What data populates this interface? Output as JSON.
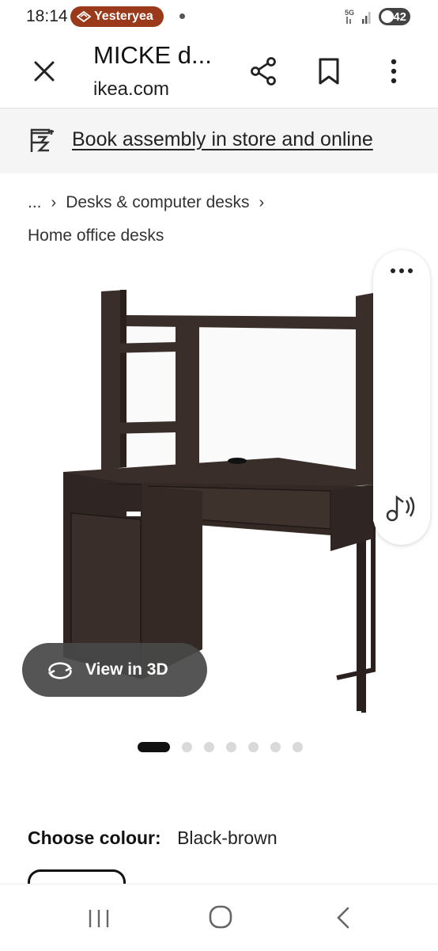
{
  "status_bar": {
    "time": "18:14",
    "notification_app": "Yesteryea",
    "battery_level": "42",
    "network": "5G"
  },
  "header": {
    "title": "MICKE d...",
    "url": "ikea.com"
  },
  "banner": {
    "assembly_link": "Book assembly in store and online"
  },
  "breadcrumb": {
    "ellipsis": "...",
    "category": "Desks & computer desks",
    "subcategory": "Home office desks"
  },
  "product_image": {
    "view_3d_label": "View in 3D",
    "carousel_total": 7,
    "carousel_active": 1
  },
  "colour": {
    "label": "Choose colour:",
    "value": "Black-brown"
  },
  "colors": {
    "notification_pill": "#9b3a1b",
    "desk": "#3a2e2a",
    "banner_bg": "#f5f5f5",
    "view3d_bg": "#484848"
  },
  "icons": {
    "close": "close-icon",
    "share": "share-icon",
    "bookmark": "bookmark-icon",
    "more": "more-vertical-icon",
    "assembly": "assembly-tool-icon",
    "rotate": "rotate-3d-icon",
    "audio": "read-aloud-icon"
  }
}
